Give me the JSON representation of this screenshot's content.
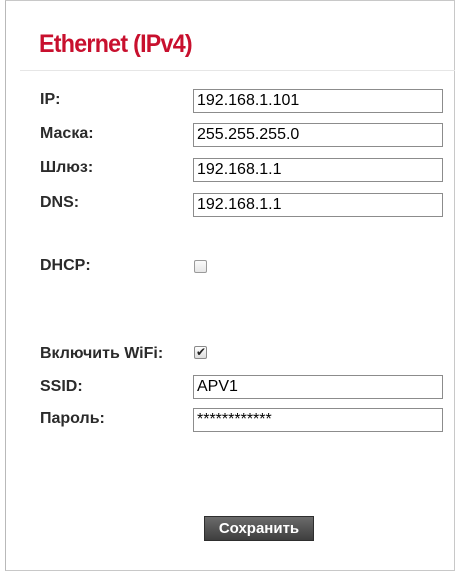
{
  "page": {
    "title": "Ethernet (IPv4)",
    "accent_color": "#c8102e"
  },
  "ethernet": {
    "ip_label": "IP:",
    "ip_value": "192.168.1.101",
    "mask_label": "Маска:",
    "mask_value": "255.255.255.0",
    "gateway_label": "Шлюз:",
    "gateway_value": "192.168.1.1",
    "dns_label": "DNS:",
    "dns_value": "192.168.1.1",
    "dhcp_label": "DHCP:",
    "dhcp_checked": false
  },
  "wifi": {
    "enable_label": "Включить WiFi:",
    "enable_checked": true,
    "ssid_label": "SSID:",
    "ssid_value": "APV1",
    "password_label": "Пароль:",
    "password_value": "************"
  },
  "actions": {
    "save_label": "Сохранить"
  }
}
